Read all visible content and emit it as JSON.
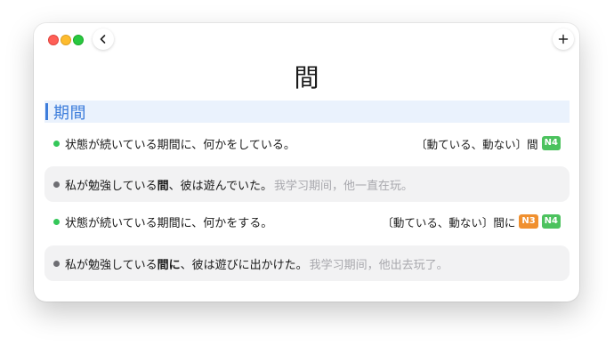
{
  "window": {
    "title_kanji": "間"
  },
  "toolbar": {
    "back_icon": "chevron-left-icon",
    "add_icon": "plus-icon"
  },
  "section": {
    "title": "期間"
  },
  "entries": [
    {
      "definition": "状態が続いている期間に、何かをしている。",
      "pattern": "〔動ている、動ない〕間",
      "levels": [
        "N4"
      ],
      "example": {
        "before": "私が勉強している",
        "highlight": "間",
        "after": "、彼は遊んでいた。",
        "translation": "我学习期间，他一直在玩。"
      }
    },
    {
      "definition": "状態が続いている期間に、何かをする。",
      "pattern": "〔動ている、動ない〕間に",
      "levels": [
        "N3",
        "N4"
      ],
      "example": {
        "before": "私が勉強している",
        "highlight": "間に",
        "after": "、彼は遊びに出かけた。",
        "translation": "我学习期间，他出去玩了。"
      }
    }
  ],
  "colors": {
    "accent": "#3d7ddb",
    "section_bg": "#eaf2fd",
    "definition_dot": "#34c759",
    "example_dot": "#6e6e73",
    "badge_n4": "#4cc25e",
    "badge_n3": "#f0902f"
  }
}
